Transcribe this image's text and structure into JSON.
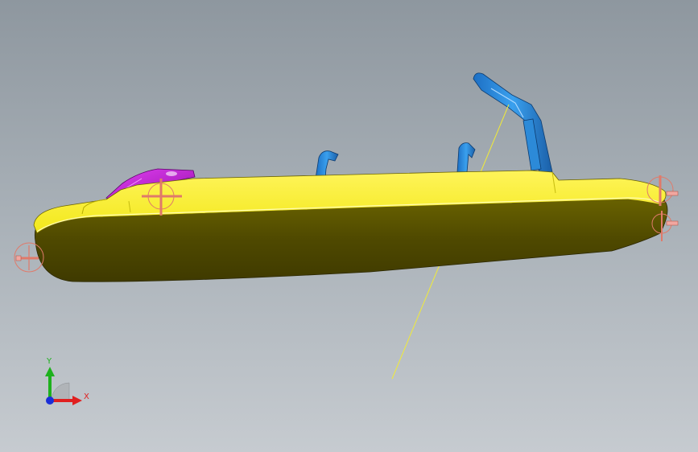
{
  "viewport": {
    "background_top": "#8e979f",
    "background_bottom": "#c6cbd0"
  },
  "model": {
    "body_color": "#f2ec1e",
    "body_shadow_color": "#5a5400",
    "bracket_color": "#c21fd6",
    "support_color": "#1f88e0",
    "mate_marker_color": "#e07a6a",
    "leader_line_color": "#f0ea3a"
  },
  "triad": {
    "y_label": "Y",
    "x_label": "X",
    "y_color": "#1db11d",
    "x_color": "#e02020",
    "z_color": "#1a2ed8"
  }
}
